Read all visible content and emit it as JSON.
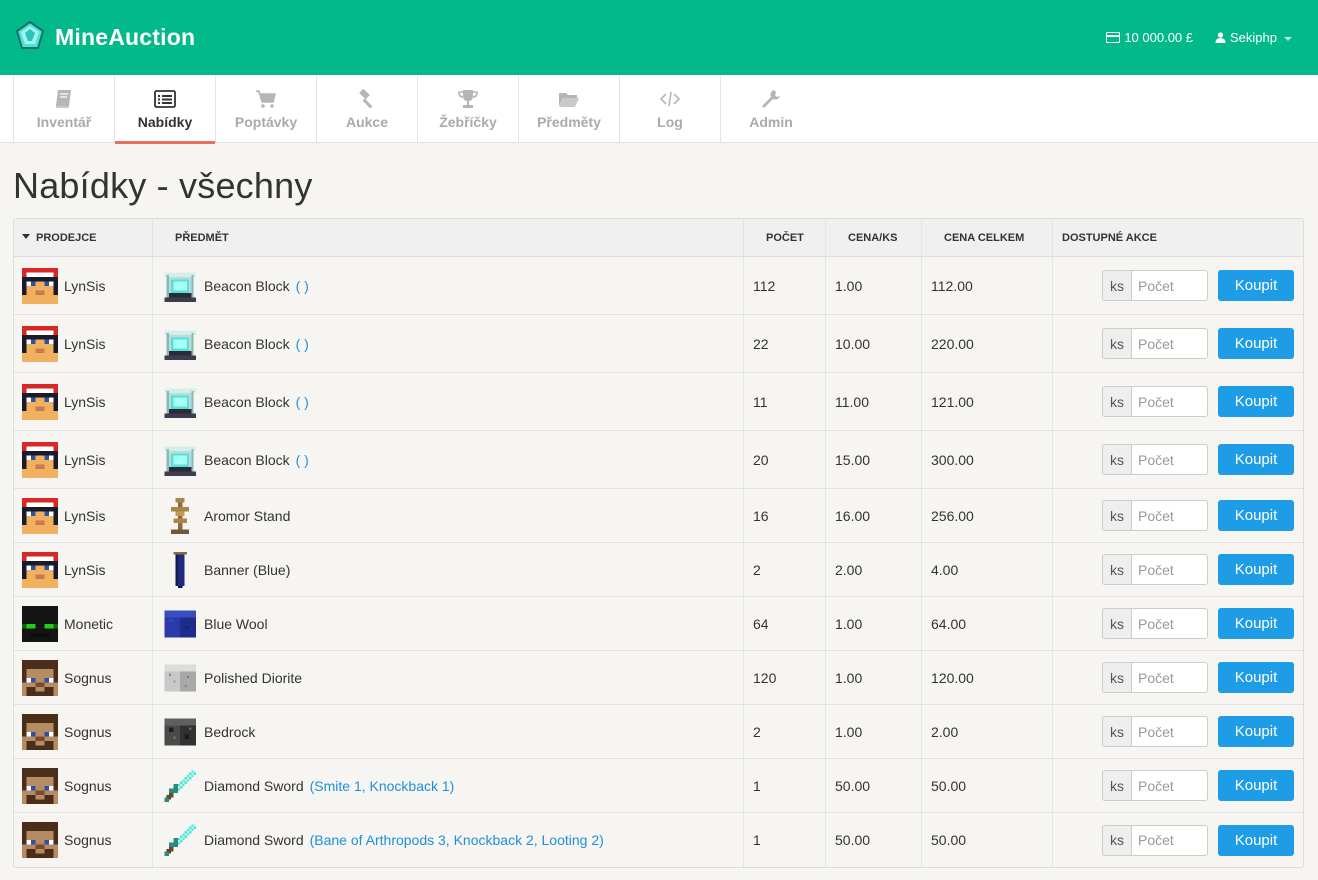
{
  "header": {
    "brand": "MineAuction",
    "balance": "10 000.00 £",
    "user": "Sekiphp"
  },
  "tabs": [
    {
      "label": "Inventář",
      "icon": "book-icon"
    },
    {
      "label": "Nabídky",
      "icon": "list-icon",
      "active": true
    },
    {
      "label": "Poptávky",
      "icon": "cart-icon"
    },
    {
      "label": "Aukce",
      "icon": "gavel-icon"
    },
    {
      "label": "Žebříčky",
      "icon": "trophy-icon"
    },
    {
      "label": "Předměty",
      "icon": "folder-open-icon"
    },
    {
      "label": "Log",
      "icon": "code-icon"
    },
    {
      "label": "Admin",
      "icon": "wrench-icon"
    }
  ],
  "page": {
    "title": "Nabídky - všechny"
  },
  "table": {
    "columns": [
      "Prodejce",
      "Předmět",
      "Počet",
      "Cena/ks",
      "Cena celkem",
      "Dostupné akce"
    ],
    "addon_label": "ks",
    "qty_placeholder": "Počet",
    "buy_label": "Koupit",
    "rows": [
      {
        "seller": "LynSis",
        "seller_avatar": "lynsis",
        "item": "Beacon Block",
        "ench": "( )",
        "item_icon": "beacon",
        "count": "112",
        "price": "1.00",
        "total": "112.00"
      },
      {
        "seller": "LynSis",
        "seller_avatar": "lynsis",
        "item": "Beacon Block",
        "ench": "( )",
        "item_icon": "beacon",
        "count": "22",
        "price": "10.00",
        "total": "220.00"
      },
      {
        "seller": "LynSis",
        "seller_avatar": "lynsis",
        "item": "Beacon Block",
        "ench": "( )",
        "item_icon": "beacon",
        "count": "11",
        "price": "11.00",
        "total": "121.00"
      },
      {
        "seller": "LynSis",
        "seller_avatar": "lynsis",
        "item": "Beacon Block",
        "ench": "( )",
        "item_icon": "beacon",
        "count": "20",
        "price": "15.00",
        "total": "300.00"
      },
      {
        "seller": "LynSis",
        "seller_avatar": "lynsis",
        "item": "Aromor Stand",
        "ench": "",
        "item_icon": "armor-stand",
        "count": "16",
        "price": "16.00",
        "total": "256.00"
      },
      {
        "seller": "LynSis",
        "seller_avatar": "lynsis",
        "item": "Banner (Blue)",
        "ench": "",
        "item_icon": "banner",
        "count": "2",
        "price": "2.00",
        "total": "4.00"
      },
      {
        "seller": "Monetic",
        "seller_avatar": "monetic",
        "item": "Blue Wool",
        "ench": "",
        "item_icon": "blue-wool",
        "count": "64",
        "price": "1.00",
        "total": "64.00"
      },
      {
        "seller": "Sognus",
        "seller_avatar": "sognus",
        "item": "Polished Diorite",
        "ench": "",
        "item_icon": "diorite",
        "count": "120",
        "price": "1.00",
        "total": "120.00"
      },
      {
        "seller": "Sognus",
        "seller_avatar": "sognus",
        "item": "Bedrock",
        "ench": "",
        "item_icon": "bedrock",
        "count": "2",
        "price": "1.00",
        "total": "2.00"
      },
      {
        "seller": "Sognus",
        "seller_avatar": "sognus",
        "item": "Diamond Sword",
        "ench": "(Smite 1, Knockback 1)",
        "item_icon": "diamond-sword",
        "count": "1",
        "price": "50.00",
        "total": "50.00"
      },
      {
        "seller": "Sognus",
        "seller_avatar": "sognus",
        "item": "Diamond Sword",
        "ench": "(Bane of Arthropods 3, Knockback 2, Looting 2)",
        "item_icon": "diamond-sword",
        "count": "1",
        "price": "50.00",
        "total": "50.00"
      }
    ]
  },
  "colors": {
    "header_bg": "#02b98a",
    "active_tab_underline": "#ec6e5e",
    "button": "#1e9ce6",
    "link": "#1e90d8"
  }
}
